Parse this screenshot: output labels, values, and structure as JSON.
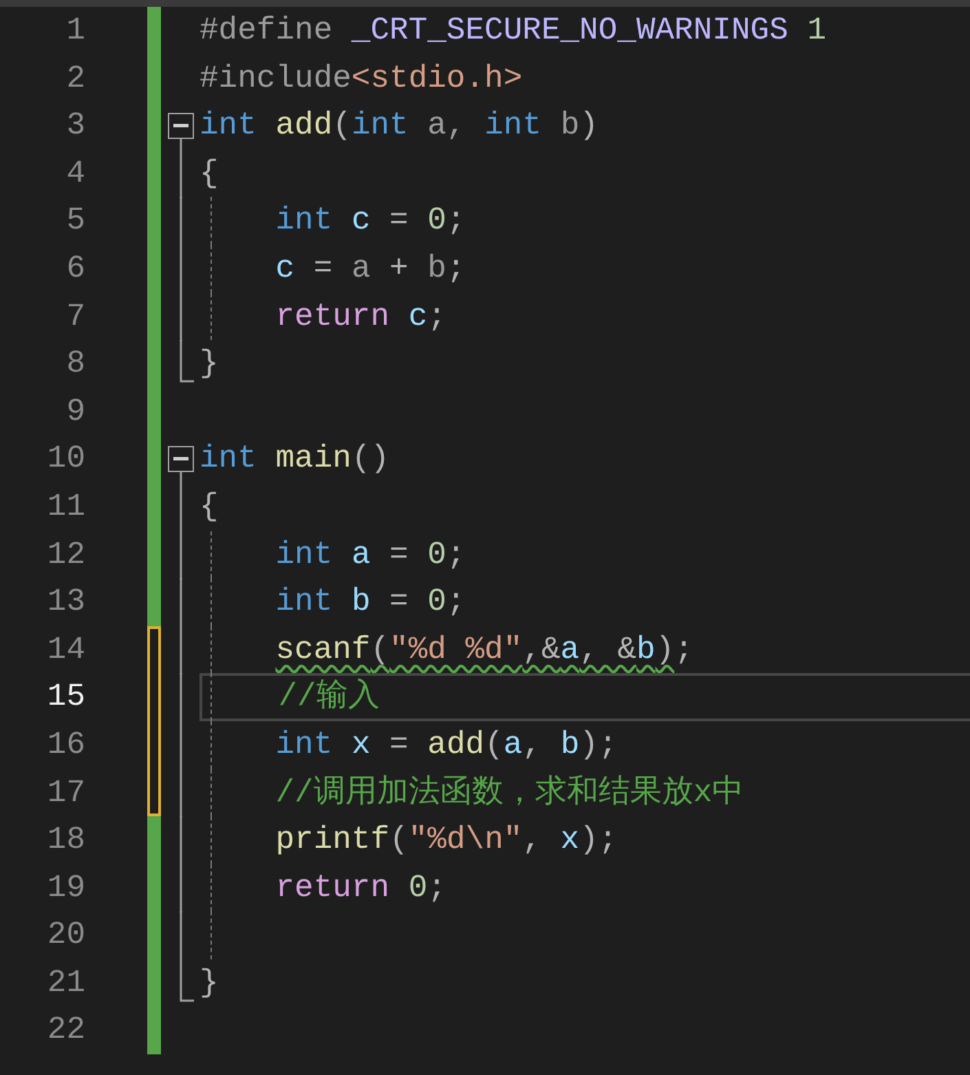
{
  "editor": {
    "lines": [
      {
        "number": "1",
        "modified": false,
        "indent_guide": false,
        "current": false,
        "tokens": [
          {
            "kind": "preprocessor",
            "text": "#define "
          },
          {
            "kind": "macro",
            "text": "_CRT_SECURE_NO_WARNINGS "
          },
          {
            "kind": "number",
            "text": "1"
          }
        ]
      },
      {
        "number": "2",
        "modified": false,
        "indent_guide": false,
        "current": false,
        "tokens": [
          {
            "kind": "preprocessor",
            "text": "#include"
          },
          {
            "kind": "string",
            "text": "<stdio.h>"
          }
        ]
      },
      {
        "number": "3",
        "modified": false,
        "indent_guide": false,
        "current": false,
        "expanded": true,
        "tokens": [
          {
            "kind": "keyword",
            "text": "int "
          },
          {
            "kind": "function",
            "text": "add"
          },
          {
            "kind": "punct",
            "text": "("
          },
          {
            "kind": "keyword",
            "text": "int "
          },
          {
            "kind": "parameter",
            "text": "a, "
          },
          {
            "kind": "keyword",
            "text": "int "
          },
          {
            "kind": "parameter",
            "text": "b"
          },
          {
            "kind": "punct",
            "text": ")"
          }
        ],
        "children": [
          {
            "number": "4",
            "modified": false,
            "indent_guide": false,
            "current": false,
            "tokens": [
              {
                "kind": "punct",
                "text": "{"
              }
            ]
          },
          {
            "number": "5",
            "modified": false,
            "indent_guide": true,
            "current": false,
            "tokens": [
              {
                "kind": "keyword",
                "text": "    int "
              },
              {
                "kind": "local",
                "text": "c "
              },
              {
                "kind": "punct",
                "text": "= "
              },
              {
                "kind": "number",
                "text": "0"
              },
              {
                "kind": "punct",
                "text": ";"
              }
            ]
          },
          {
            "number": "6",
            "modified": false,
            "indent_guide": true,
            "current": false,
            "tokens": [
              {
                "kind": "local",
                "text": "    c "
              },
              {
                "kind": "punct",
                "text": "= "
              },
              {
                "kind": "parameter",
                "text": "a "
              },
              {
                "kind": "punct",
                "text": "+ "
              },
              {
                "kind": "parameter",
                "text": "b"
              },
              {
                "kind": "punct",
                "text": ";"
              }
            ]
          },
          {
            "number": "7",
            "modified": false,
            "indent_guide": true,
            "current": false,
            "tokens": [
              {
                "kind": "control",
                "text": "    return "
              },
              {
                "kind": "local",
                "text": "c"
              },
              {
                "kind": "punct",
                "text": ";"
              }
            ]
          },
          {
            "number": "8",
            "modified": false,
            "indent_guide": false,
            "current": false,
            "tokens": [
              {
                "kind": "punct",
                "text": "}"
              }
            ]
          }
        ]
      },
      {
        "number": "9",
        "modified": false,
        "indent_guide": false,
        "current": false
      },
      {
        "number": "10",
        "modified": false,
        "indent_guide": false,
        "current": false,
        "expanded": true,
        "tokens": [
          {
            "kind": "keyword",
            "text": "int "
          },
          {
            "kind": "function",
            "text": "main"
          },
          {
            "kind": "punct",
            "text": "()"
          }
        ],
        "children": [
          {
            "number": "11",
            "modified": false,
            "indent_guide": false,
            "current": false,
            "tokens": [
              {
                "kind": "punct",
                "text": "{"
              }
            ]
          },
          {
            "number": "12",
            "modified": false,
            "indent_guide": true,
            "current": false,
            "tokens": [
              {
                "kind": "keyword",
                "text": "    int "
              },
              {
                "kind": "local",
                "text": "a "
              },
              {
                "kind": "punct",
                "text": "= "
              },
              {
                "kind": "number",
                "text": "0"
              },
              {
                "kind": "punct",
                "text": ";"
              }
            ]
          },
          {
            "number": "13",
            "modified": false,
            "indent_guide": true,
            "current": false,
            "tokens": [
              {
                "kind": "keyword",
                "text": "    int "
              },
              {
                "kind": "local",
                "text": "b "
              },
              {
                "kind": "punct",
                "text": "= "
              },
              {
                "kind": "number",
                "text": "0"
              },
              {
                "kind": "punct",
                "text": ";"
              }
            ]
          },
          {
            "number": "14",
            "modified": true,
            "indent_guide": true,
            "current": false,
            "tokens": [
              {
                "kind": "warning",
                "tokens": [
                  {
                    "kind": "function",
                    "text": "    scanf"
                  },
                  {
                    "kind": "punct",
                    "text": "("
                  },
                  {
                    "kind": "string",
                    "text": "\"%d %d\""
                  },
                  {
                    "kind": "punct",
                    "text": ",&"
                  },
                  {
                    "kind": "local",
                    "text": "a"
                  },
                  {
                    "kind": "punct",
                    "text": ", &"
                  },
                  {
                    "kind": "local",
                    "text": "b"
                  },
                  {
                    "kind": "punct",
                    "text": ")"
                  }
                ]
              },
              {
                "kind": "punct",
                "text": ";"
              }
            ]
          },
          {
            "number": "15",
            "modified": true,
            "indent_guide": true,
            "current": true,
            "tokens": [
              {
                "kind": "comment",
                "text": "    //输入"
              }
            ]
          },
          {
            "number": "16",
            "modified": true,
            "indent_guide": true,
            "current": false,
            "tokens": [
              {
                "kind": "keyword",
                "text": "    int "
              },
              {
                "kind": "local",
                "text": "x "
              },
              {
                "kind": "punct",
                "text": "= "
              },
              {
                "kind": "function",
                "text": "add"
              },
              {
                "kind": "punct",
                "text": "("
              },
              {
                "kind": "local",
                "text": "a"
              },
              {
                "kind": "punct",
                "text": ", "
              },
              {
                "kind": "local",
                "text": "b"
              },
              {
                "kind": "punct",
                "text": ");"
              }
            ]
          },
          {
            "number": "17",
            "modified": true,
            "indent_guide": true,
            "current": false,
            "tokens": [
              {
                "kind": "comment",
                "text": "    //调用加法函数，求和结果放x中"
              }
            ]
          },
          {
            "number": "18",
            "modified": false,
            "indent_guide": true,
            "current": false,
            "tokens": [
              {
                "kind": "function",
                "text": "    printf"
              },
              {
                "kind": "punct",
                "text": "("
              },
              {
                "kind": "string",
                "text": "\"%d\\n\""
              },
              {
                "kind": "punct",
                "text": ", "
              },
              {
                "kind": "local",
                "text": "x"
              },
              {
                "kind": "punct",
                "text": ");"
              }
            ]
          },
          {
            "number": "19",
            "modified": false,
            "indent_guide": true,
            "current": false,
            "tokens": [
              {
                "kind": "control",
                "text": "    return "
              },
              {
                "kind": "number",
                "text": "0"
              },
              {
                "kind": "punct",
                "text": ";"
              }
            ]
          },
          {
            "number": "20",
            "modified": false,
            "indent_guide": true,
            "current": false
          },
          {
            "number": "21",
            "modified": false,
            "indent_guide": false,
            "current": false,
            "tokens": [
              {
                "kind": "punct",
                "text": "}"
              }
            ]
          }
        ]
      },
      {
        "number": "22",
        "modified": false,
        "indent_guide": false,
        "current": false
      }
    ]
  }
}
